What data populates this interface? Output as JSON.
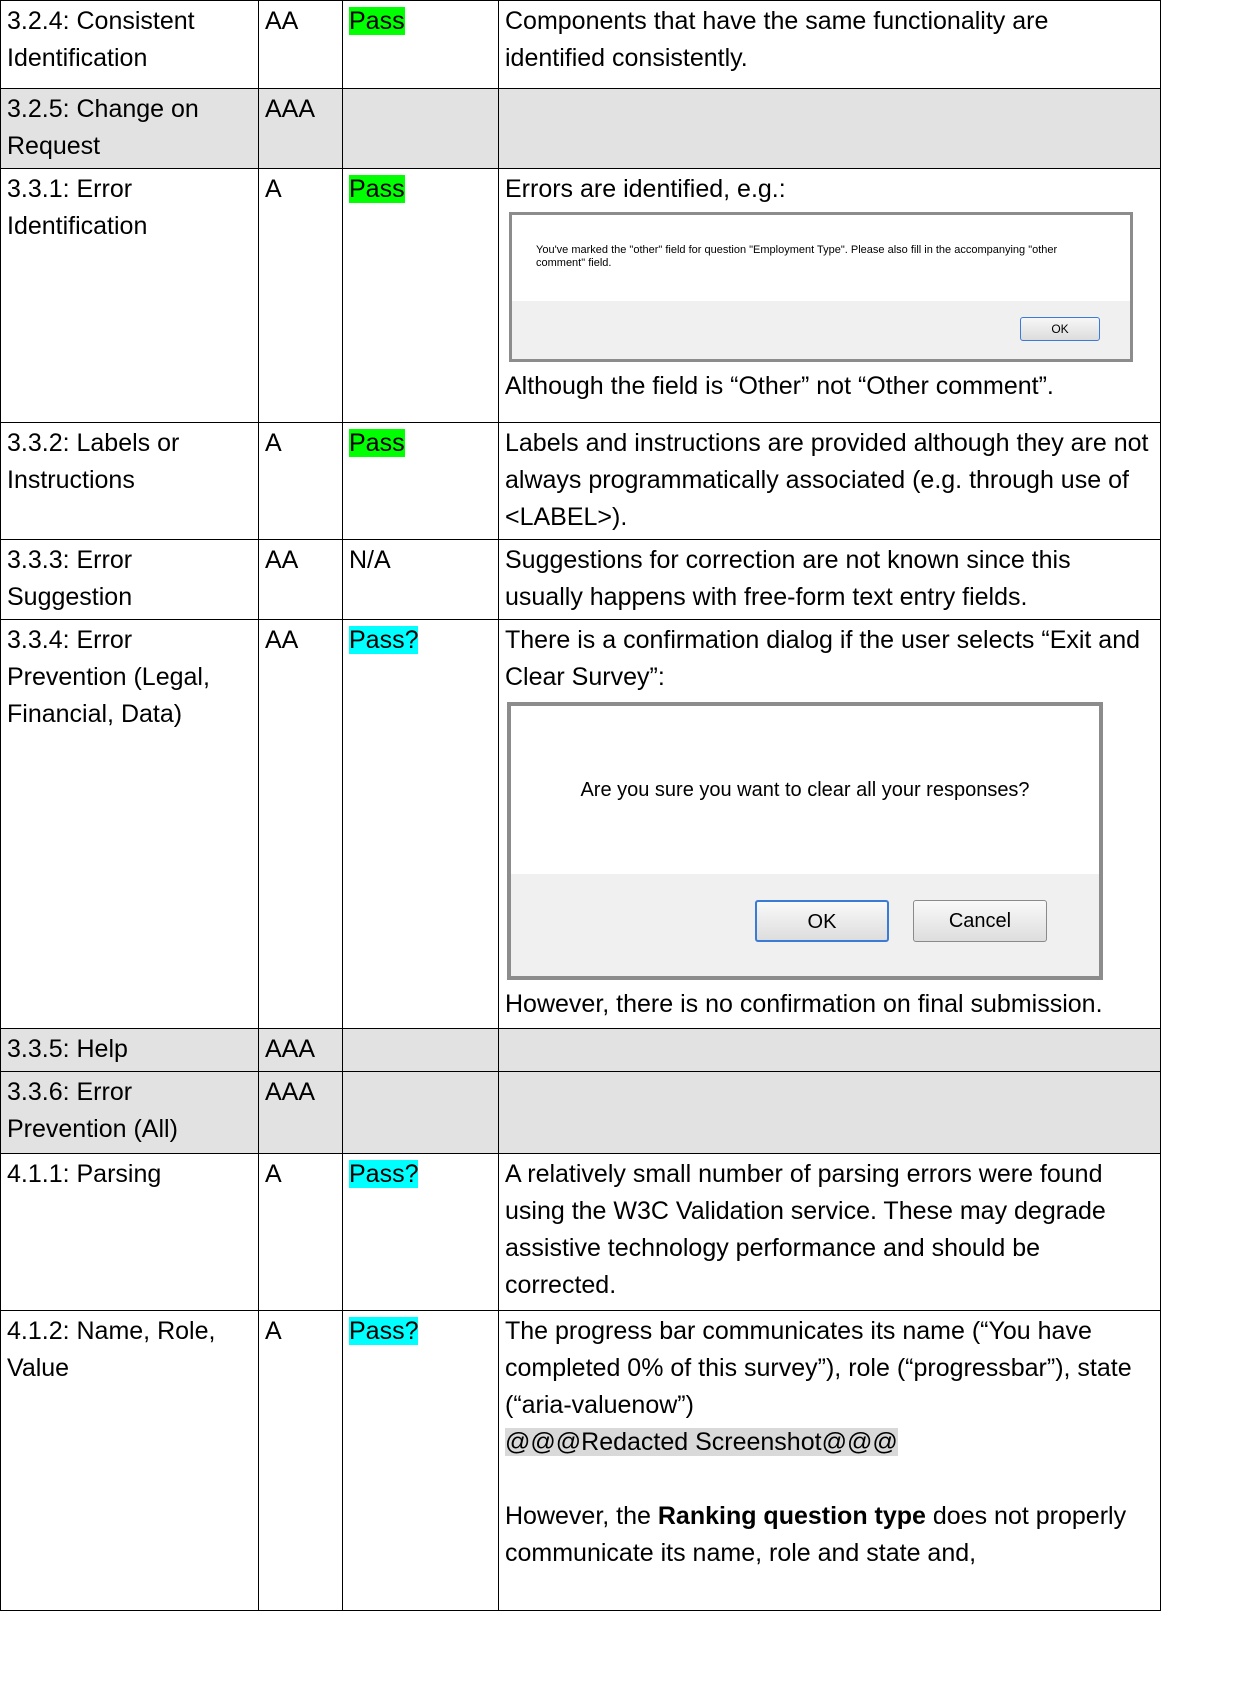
{
  "rows": [
    {
      "criterion": "3.2.4: Consistent Identification",
      "level": "AA",
      "result": "Pass",
      "text": "Components that have the same functionality are identified consistently."
    },
    {
      "criterion": "3.2.5: Change on Request",
      "level": "AAA",
      "result": "",
      "text": ""
    },
    {
      "criterion": "3.3.1: Error Identification",
      "level": "A",
      "result": "Pass",
      "text": "Errors are identified, e.g.:",
      "text_after": "Although the field is “Other” not “Other comment”."
    },
    {
      "criterion": "3.3.2: Labels or Instructions",
      "level": "A",
      "result": "Pass",
      "text": "Labels and instructions are provided although they are not always programmatically associated (e.g. through use of <LABEL>)."
    },
    {
      "criterion": "3.3.3: Error Suggestion",
      "level": "AA",
      "result": "N/A",
      "text": "Suggestions for correction are not known since this usually happens with free-form text entry fields."
    },
    {
      "criterion": "3.3.4: Error Prevention (Legal, Financial, Data)",
      "level": "AA",
      "result": "Pass?",
      "text": "There is a confirmation dialog if the user selects “Exit and Clear Survey”:",
      "text_after": "However, there is no confirmation on final submission."
    },
    {
      "criterion": "3.3.5: Help",
      "level": "AAA",
      "result": "",
      "text": ""
    },
    {
      "criterion": "3.3.6: Error Prevention (All)",
      "level": "AAA",
      "result": "",
      "text": ""
    },
    {
      "criterion": "4.1.1: Parsing",
      "level": "A",
      "result": "Pass?",
      "text": "A relatively small number of parsing errors were found using the W3C Validation service. These may degrade assistive technology performance and should be corrected."
    },
    {
      "criterion": "4.1.2: Name, Role, Value",
      "level": "A",
      "result": "Pass?",
      "text": "The progress bar communicates its name (“You have completed 0% of this survey”), role (“progressbar”), state (“aria-valuenow”)",
      "redacted": "@@@Redacted Screenshot@@@",
      "text_after_pre": "However, the ",
      "text_after_bold": "Ranking question type",
      "text_after_post": " does not properly communicate its name, role and state and,"
    }
  ],
  "dialog_error": {
    "message": "You've marked the \"other\" field for question \"Employment Type\". Please also fill in the accompanying \"other comment\" field.",
    "ok_label": "OK"
  },
  "dialog_confirm": {
    "message": "Are you sure you want to clear all your responses?",
    "ok_label": "OK",
    "cancel_label": "Cancel"
  },
  "colors": {
    "pass": "#00ff00",
    "pass_uncertain": "#00ffff",
    "aaa_row": "#e2e2e2"
  }
}
